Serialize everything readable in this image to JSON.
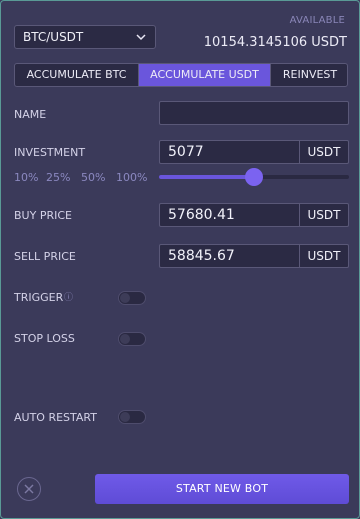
{
  "pair": {
    "selected": "BTC/USDT"
  },
  "balance": {
    "label": "AVAILABLE",
    "value": "10154.3145106 USDT"
  },
  "tabs": [
    {
      "label": "ACCUMULATE BTC",
      "active": false
    },
    {
      "label": "ACCUMULATE USDT",
      "active": true
    },
    {
      "label": "REINVEST",
      "active": false
    }
  ],
  "form": {
    "name": {
      "label": "NAME",
      "value": ""
    },
    "investment": {
      "label": "INVESTMENT",
      "value": "5077",
      "unit": "USDT",
      "presets": [
        "10%",
        "25%",
        "50%",
        "100%"
      ],
      "slider_fraction": 0.5
    },
    "buy_price": {
      "label": "BUY PRICE",
      "value": "57680.41",
      "unit": "USDT"
    },
    "sell_price": {
      "label": "SELL PRICE",
      "value": "58845.67",
      "unit": "USDT"
    },
    "trigger": {
      "label": "TRIGGER",
      "enabled": false
    },
    "stop_loss": {
      "label": "STOP LOSS",
      "enabled": false
    },
    "auto_restart": {
      "label": "AUTO RESTART",
      "enabled": false
    }
  },
  "actions": {
    "start_label": "START NEW BOT"
  },
  "colors": {
    "accent": "#6a56dc",
    "background": "#3b3a5a",
    "field": "#2b2a44",
    "border": "#5a9a96"
  },
  "icons": {
    "close": "close-circle-icon",
    "info": "info-icon",
    "chevron": "chevron-down-icon"
  }
}
